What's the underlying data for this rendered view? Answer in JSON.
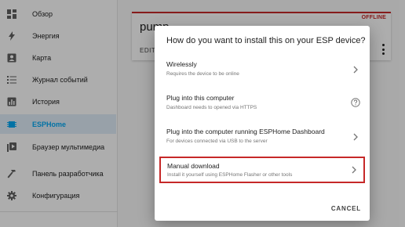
{
  "sidebar": {
    "items": [
      {
        "label": "Обзор",
        "icon": "dashboard-icon"
      },
      {
        "label": "Энергия",
        "icon": "lightning-icon"
      },
      {
        "label": "Карта",
        "icon": "map-icon"
      },
      {
        "label": "Журнал событий",
        "icon": "logbook-icon"
      },
      {
        "label": "История",
        "icon": "history-icon"
      },
      {
        "label": "ESPHome",
        "icon": "chip-icon",
        "active": true
      },
      {
        "label": "Браузер мультимедиа",
        "icon": "media-icon"
      },
      {
        "label": "Панель разработчика",
        "icon": "hammer-icon"
      },
      {
        "label": "Конфигурация",
        "icon": "gear-icon"
      }
    ]
  },
  "device_card": {
    "title": "pump",
    "status": "OFFLINE",
    "edit_label": "EDIT"
  },
  "dialog": {
    "title": "How do you want to install this on your ESP device?",
    "options": [
      {
        "title": "Wirelessly",
        "subtitle": "Requires the device to be online",
        "icon": "chevron-right-icon"
      },
      {
        "title": "Plug into this computer",
        "subtitle": "Dashboard needs to opened via HTTPS",
        "icon": "help-circle-icon"
      },
      {
        "title": "Plug into the computer running ESPHome Dashboard",
        "subtitle": "For devices connected via USB to the server",
        "icon": "chevron-right-icon"
      },
      {
        "title": "Manual download",
        "subtitle": "Install it yourself using ESPHome Flasher or other tools",
        "icon": "chevron-right-icon",
        "highlighted": true
      }
    ],
    "cancel_label": "CANCEL"
  },
  "colors": {
    "accent": "#03a9f4",
    "active_bg": "#e1eef9",
    "offline": "#c62828",
    "highlight_border": "#c62828"
  }
}
